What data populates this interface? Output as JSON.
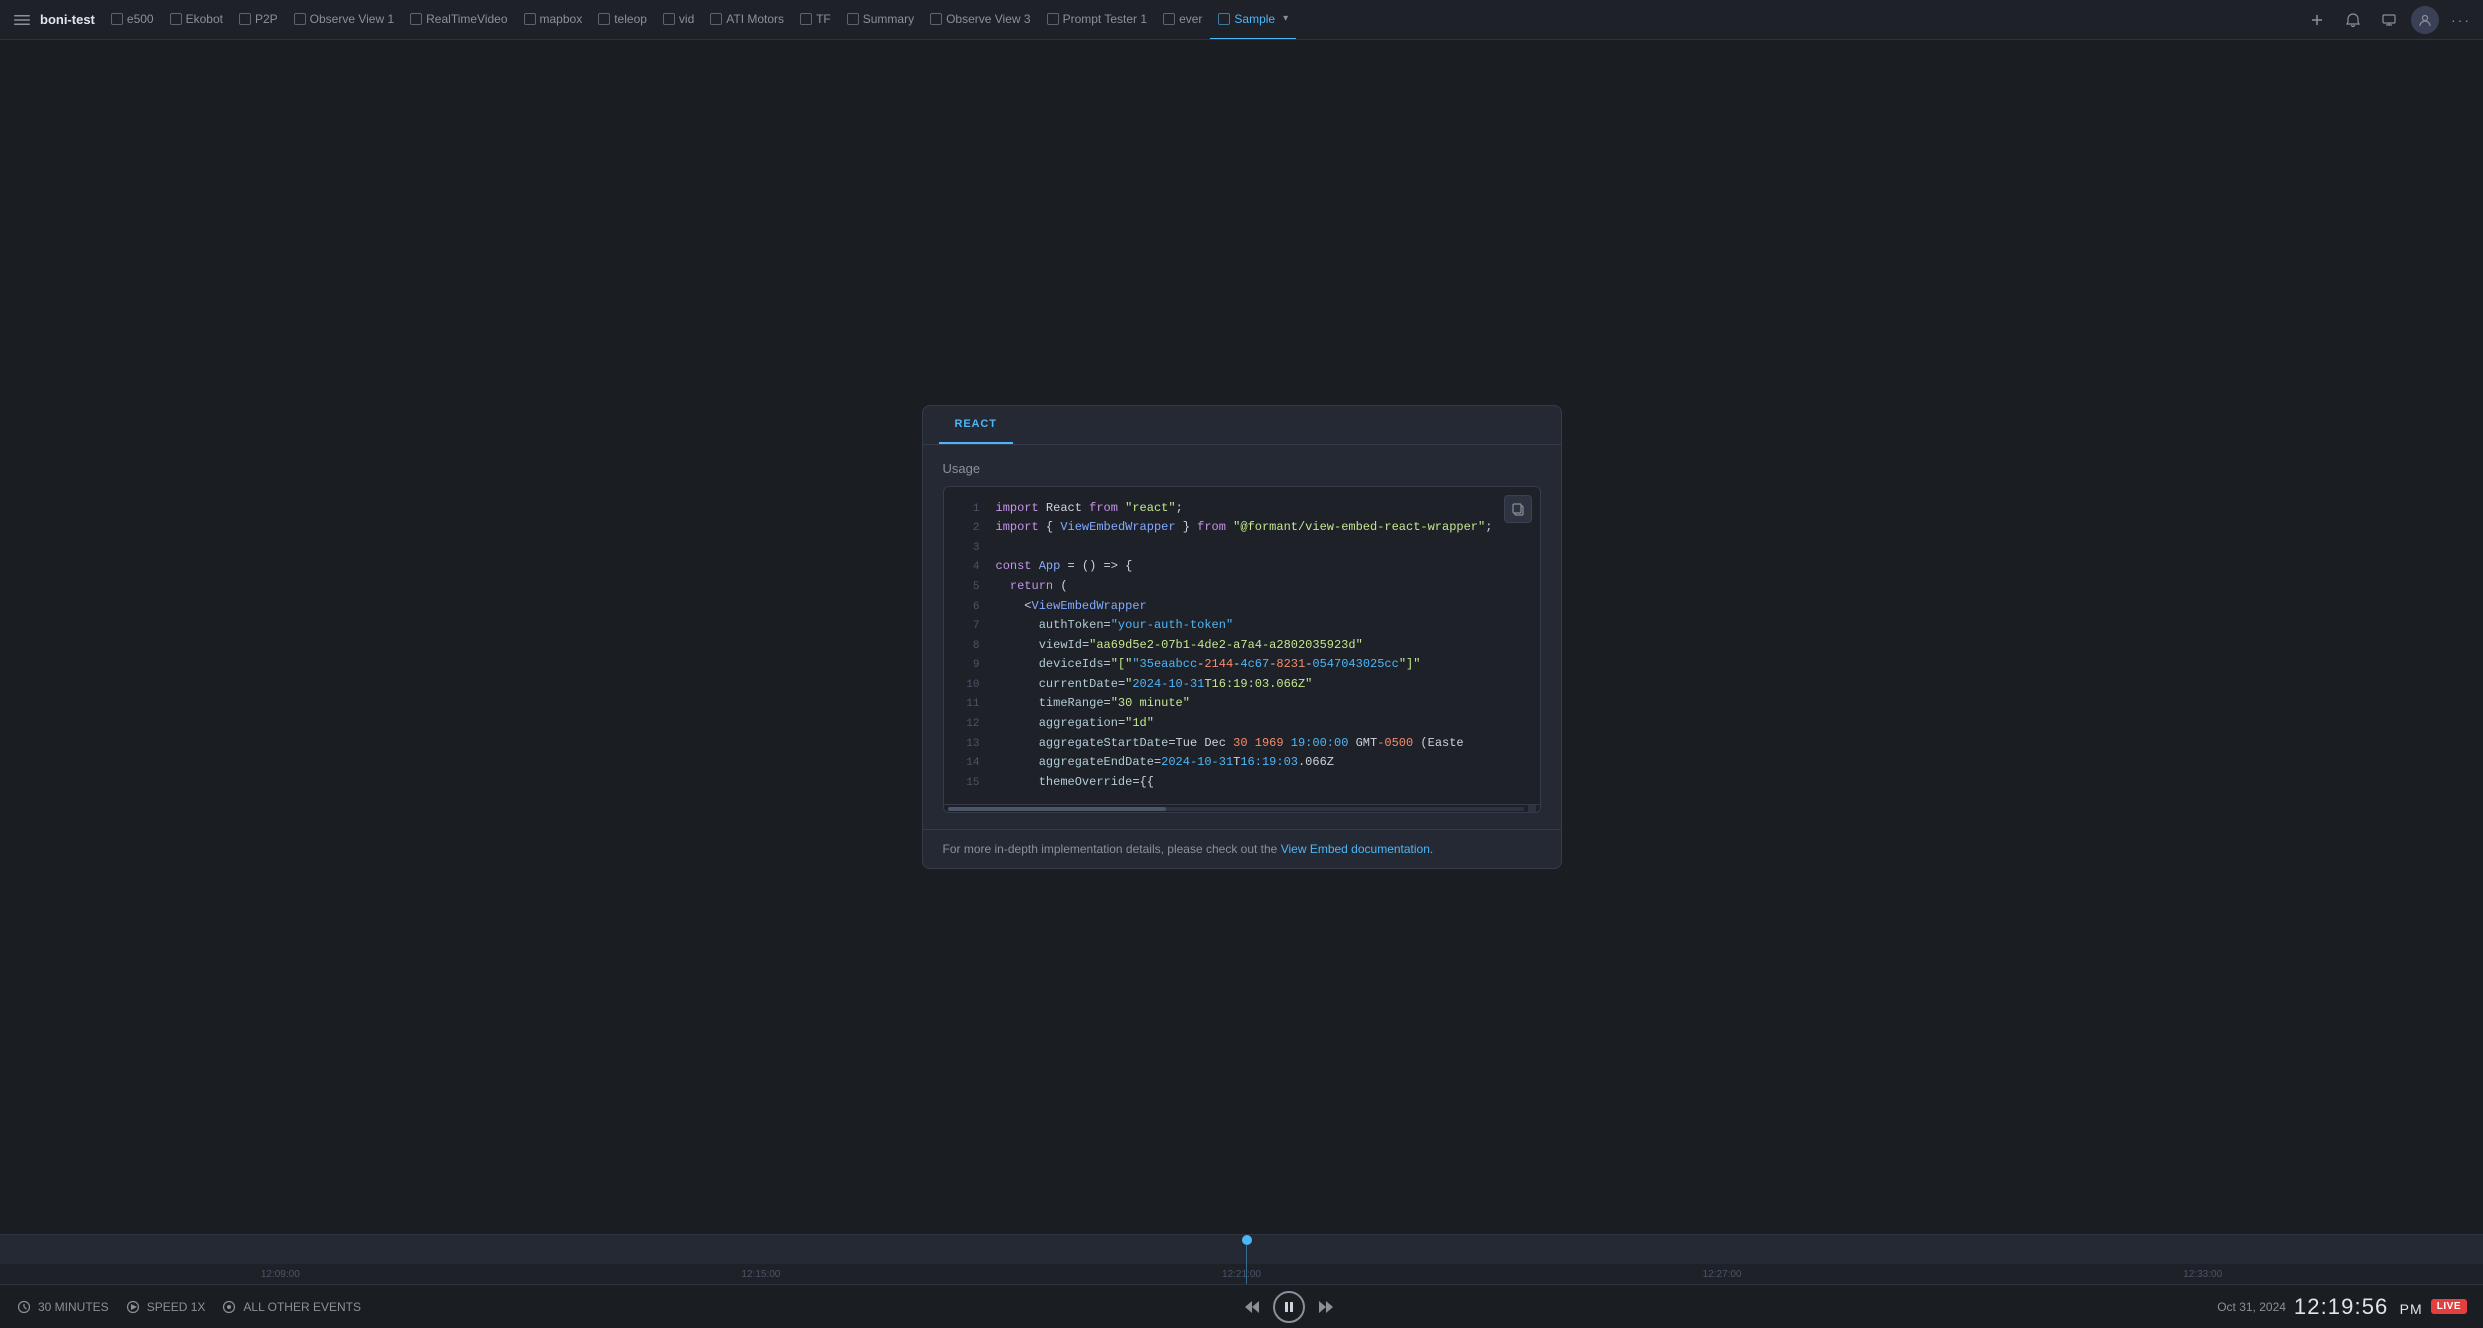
{
  "topbar": {
    "menu_label": "☰",
    "app_name": "boni-test",
    "tabs": [
      {
        "id": "e500",
        "label": "e500",
        "active": false
      },
      {
        "id": "ekobot",
        "label": "Ekobot",
        "active": false
      },
      {
        "id": "p2p",
        "label": "P2P",
        "active": false
      },
      {
        "id": "observe-view-1",
        "label": "Observe View 1",
        "active": false
      },
      {
        "id": "realtimevideo",
        "label": "RealTimeVideo",
        "active": false
      },
      {
        "id": "mapbox",
        "label": "mapbox",
        "active": false
      },
      {
        "id": "teleop",
        "label": "teleop",
        "active": false
      },
      {
        "id": "vid",
        "label": "vid",
        "active": false
      },
      {
        "id": "ati-motors",
        "label": "ATI Motors",
        "active": false
      },
      {
        "id": "tf",
        "label": "TF",
        "active": false
      },
      {
        "id": "summary",
        "label": "Summary",
        "active": false
      },
      {
        "id": "observe-view-3",
        "label": "Observe View 3",
        "active": false
      },
      {
        "id": "prompt-tester-1",
        "label": "Prompt Tester 1",
        "active": false
      },
      {
        "id": "ever",
        "label": "ever",
        "active": false
      },
      {
        "id": "sample",
        "label": "Sample",
        "active": true
      }
    ],
    "add_tab_label": "+",
    "notification_label": "🔔",
    "screen_label": "⊡",
    "more_label": "···"
  },
  "modal": {
    "tab_label": "REACT",
    "usage_label": "Usage",
    "copy_tooltip": "Copy",
    "code_lines": [
      {
        "num": 1,
        "text": "import React from \"react\";"
      },
      {
        "num": 2,
        "text": "import { ViewEmbedWrapper } from \"@formant/view-embed-react-wrapper\";"
      },
      {
        "num": 3,
        "text": ""
      },
      {
        "num": 4,
        "text": "const App = () => {"
      },
      {
        "num": 5,
        "text": "  return ("
      },
      {
        "num": 6,
        "text": "    <ViewEmbedWrapper"
      },
      {
        "num": 7,
        "text": "      authToken=\"your-auth-token\""
      },
      {
        "num": 8,
        "text": "      viewId=\"aa69d5e2-07b1-4de2-a7a4-a2802035923d\""
      },
      {
        "num": 9,
        "text": "      deviceIds=\"[\\\"35eaabcc-2144-4c67-8231-0547043025cc\\\"]\""
      },
      {
        "num": 10,
        "text": "      currentDate=\"2024-10-31T16:19:03.066Z\""
      },
      {
        "num": 11,
        "text": "      timeRange=\"30 minute\""
      },
      {
        "num": 12,
        "text": "      aggregation=\"1d\""
      },
      {
        "num": 13,
        "text": "      aggregateStartDate=Tue Dec 30 1969 19:00:00 GMT-0500 (Easte"
      },
      {
        "num": 14,
        "text": "      aggregateEndDate=2024-10-31T16:19:03.066Z"
      },
      {
        "num": 15,
        "text": "      themeOverride={{"
      }
    ],
    "footer_text": "For more in-depth implementation details, please check out the ",
    "footer_link_text": "View Embed documentation.",
    "footer_link_href": "#"
  },
  "timeline": {
    "labels": [
      "12:09:00",
      "12:15:00",
      "12:21:00",
      "12:27:00",
      "12:33:00"
    ]
  },
  "controls": {
    "duration_label": "30 MINUTES",
    "speed_label": "SPEED 1X",
    "events_label": "ALL OTHER EVENTS",
    "date_label": "Oct 31, 2024",
    "time_label": "12:19:56",
    "am_pm_label": "PM",
    "live_label": "LIVE"
  }
}
